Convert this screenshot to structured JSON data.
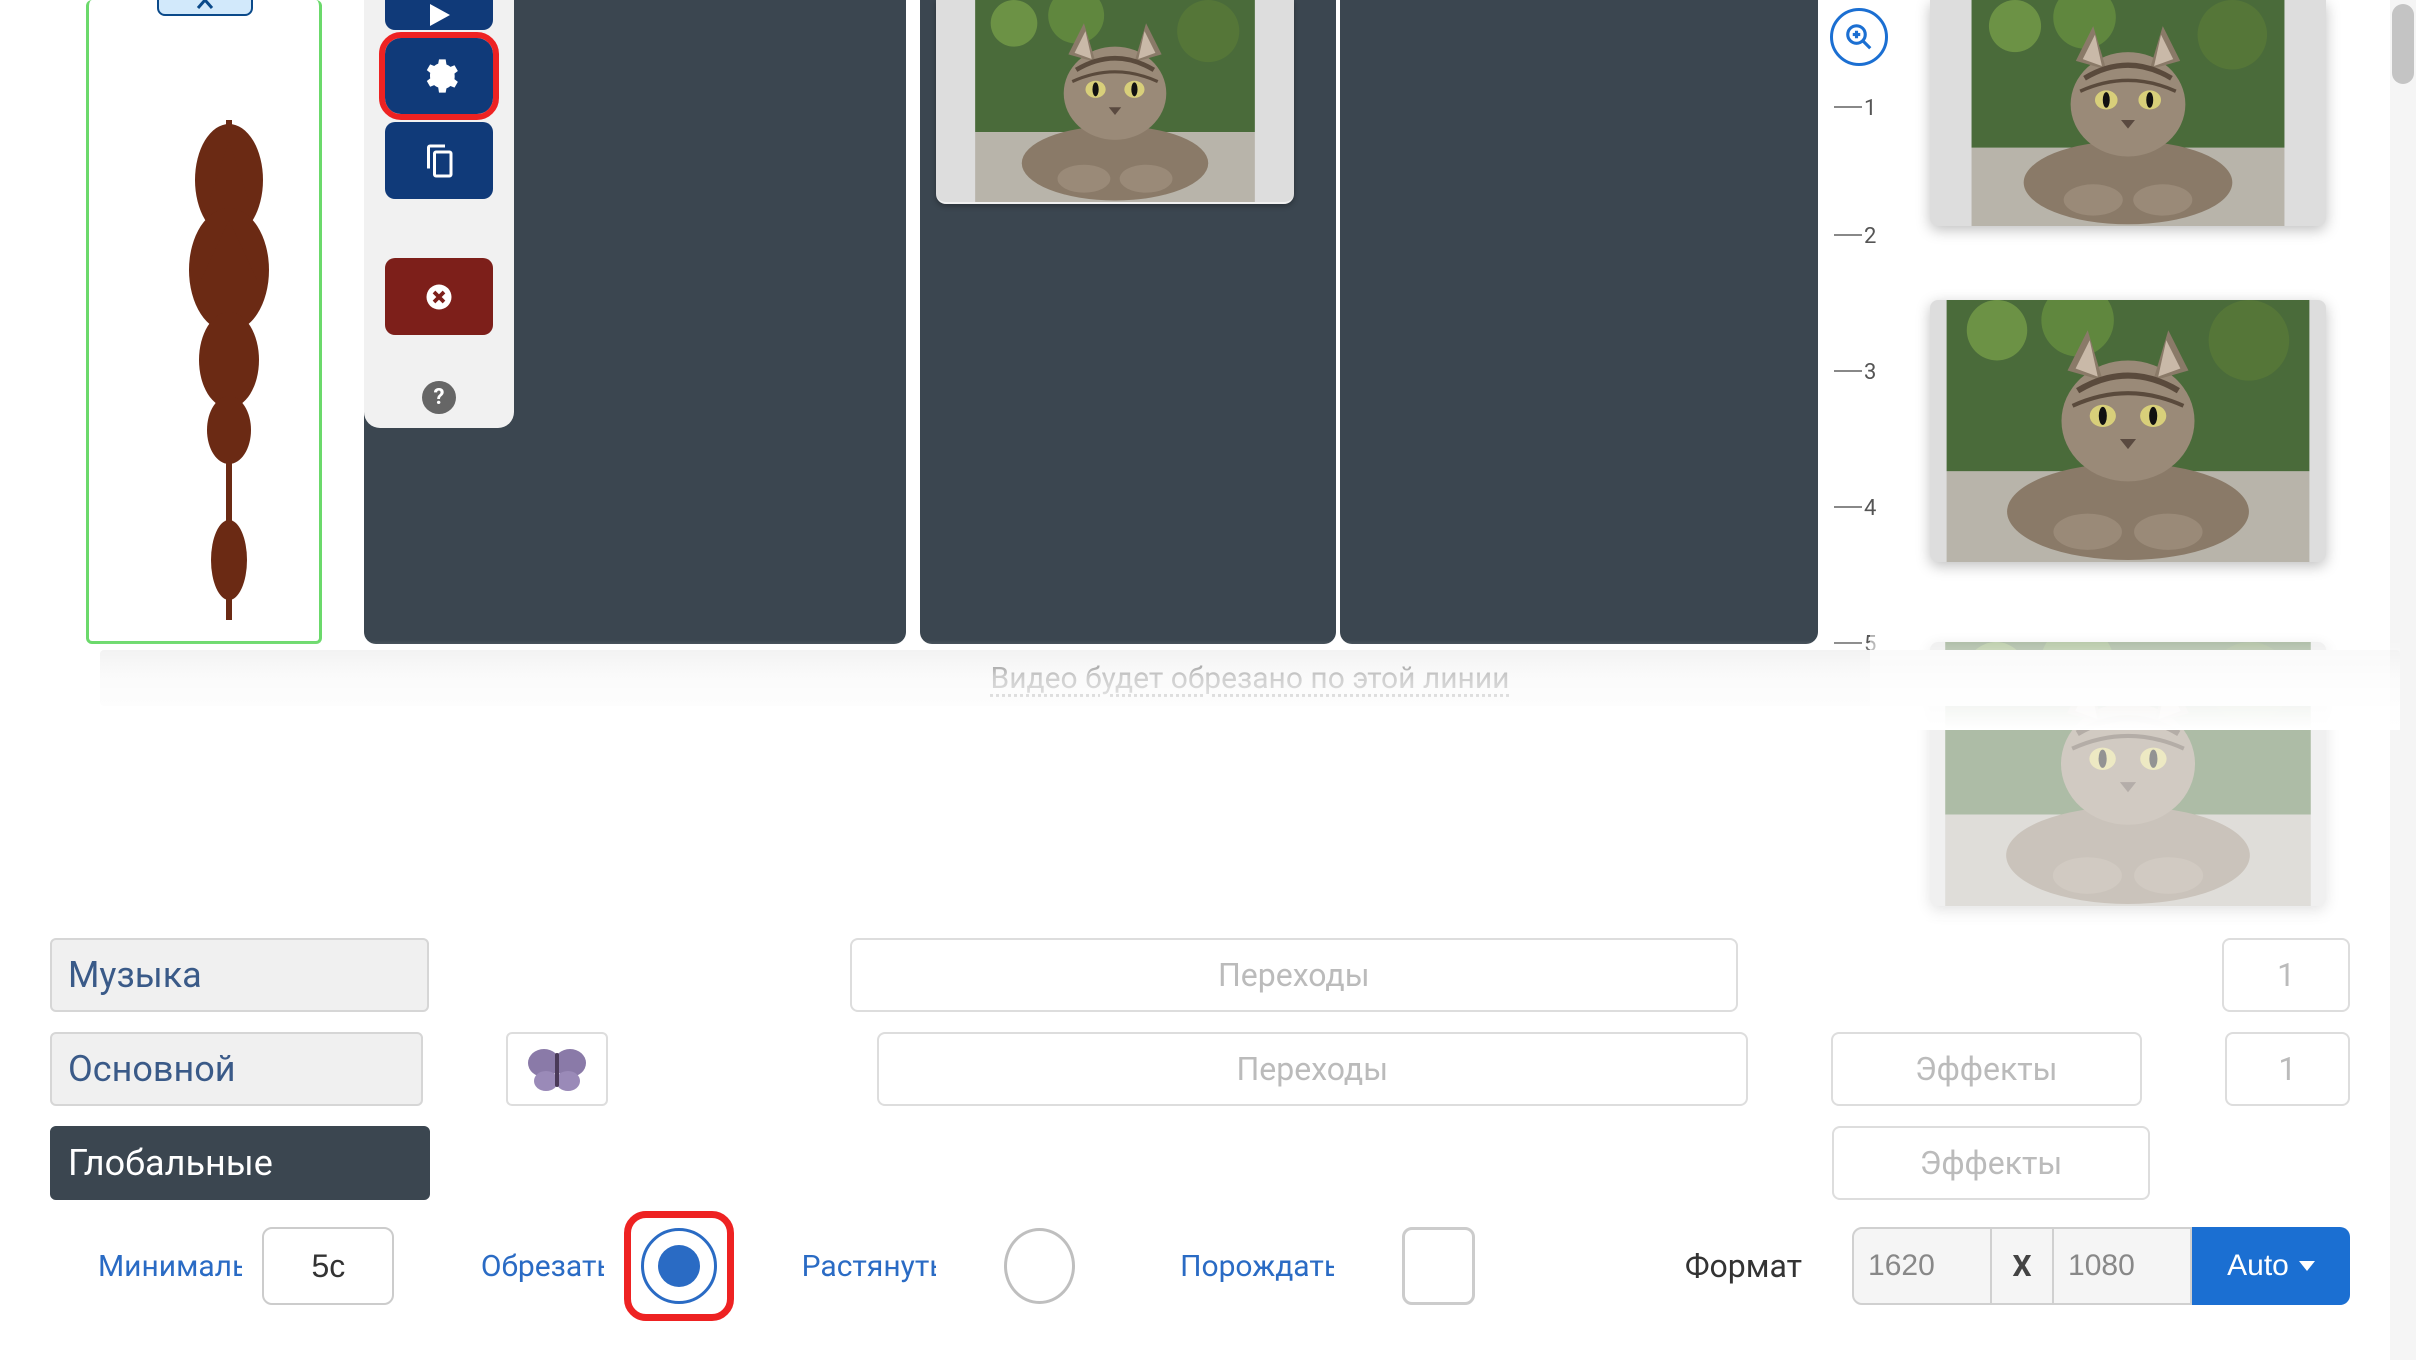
{
  "editor": {
    "toolbar": {
      "play": "play",
      "settings": "settings",
      "copy": "copy",
      "delete": "delete",
      "help": "?"
    },
    "zoom_icon": "zoom-in",
    "ruler": {
      "ticks": [
        "1",
        "2",
        "3",
        "4",
        "5"
      ]
    },
    "cut_line": "Видео будет обрезано по этой линии"
  },
  "bottom": {
    "sections": {
      "music": "Музыка",
      "main": "Основной",
      "global": "Глобальные"
    },
    "transitions": "Переходы",
    "effects": "Эффекты",
    "count1": "1",
    "count2": "1"
  },
  "settings": {
    "min_label": "Минимальн",
    "min_value": "5с",
    "crop_label": "Обрезать",
    "stretch_label": "Растянуть",
    "spawn_label": "Порождать",
    "format_label": "Формат",
    "width": "1620",
    "sep": "X",
    "height": "1080",
    "auto": "Auto"
  }
}
